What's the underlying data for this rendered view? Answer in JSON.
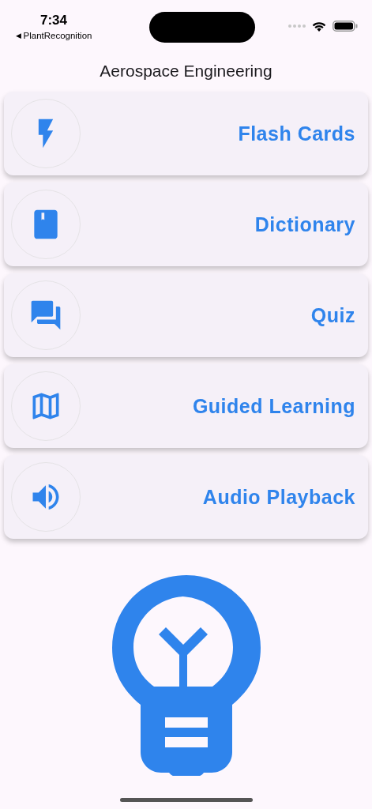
{
  "status_bar": {
    "time": "7:34",
    "back_arrow": "◀",
    "back_label": "PlantRecognition"
  },
  "title": "Aerospace Engineering",
  "menu": [
    {
      "kind": "flash",
      "label": "Flash Cards"
    },
    {
      "kind": "book",
      "label": "Dictionary"
    },
    {
      "kind": "chat",
      "label": "Quiz"
    },
    {
      "kind": "map",
      "label": "Guided Learning"
    },
    {
      "kind": "speaker",
      "label": "Audio Playback"
    }
  ]
}
